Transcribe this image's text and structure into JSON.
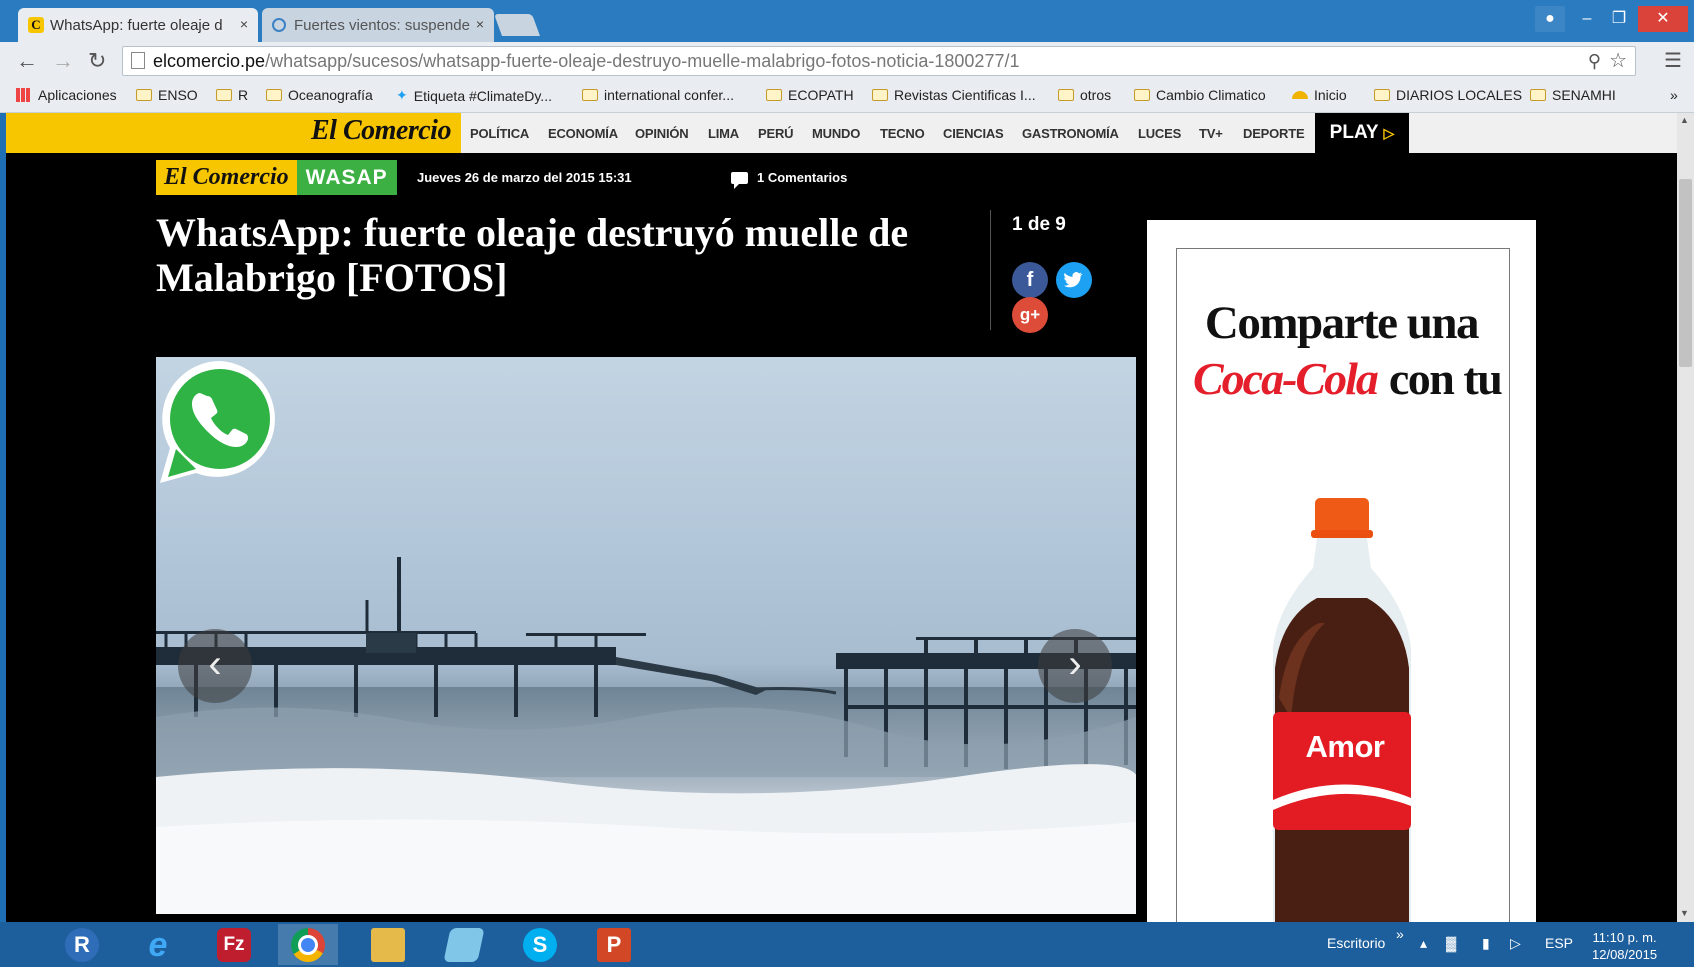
{
  "browser": {
    "tabs": [
      {
        "label": "WhatsApp: fuerte oleaje d",
        "close": "×",
        "active": true
      },
      {
        "label": "Fuertes vientos: suspende",
        "close": "×",
        "active": false
      }
    ],
    "url_host": "elcomercio.pe",
    "url_path": "/whatsapp/sucesos/whatsapp-fuerte-oleaje-destruyo-muelle-malabrigo-fotos-noticia-1800277/1",
    "bookmarks": [
      "Aplicaciones",
      "ENSO",
      "R",
      "Oceanografía",
      "Etiqueta #ClimateDy...",
      "international confer...",
      "ECOPATH",
      "Revistas Cientificas I...",
      "otros",
      "Cambio Climatico",
      "Inicio",
      "DIARIOS LOCALES",
      "SENAMHI"
    ],
    "bookmarks_overflow": "»"
  },
  "site": {
    "brand": "El Comercio",
    "nav": [
      "POLÍTICA",
      "ECONOMÍA",
      "OPINIÓN",
      "LIMA",
      "PERÚ",
      "MUNDO",
      "TECNO",
      "CIENCIAS",
      "GASTRONOMÍA",
      "LUCES",
      "TV+",
      "DEPORTE"
    ],
    "play_label": "PLAY"
  },
  "article": {
    "logo_brand": "El Comercio",
    "logo_section": "WASAP",
    "date": "Jueves 26 de marzo del 2015 15:31",
    "comments": "1 Comentarios",
    "headline": "WhatsApp: fuerte oleaje destruyó muelle de Malabrigo [FOTOS]",
    "counter": "1 de 9",
    "social": {
      "facebook": "f",
      "google": "g+"
    },
    "prev_glyph": "‹",
    "next_glyph": "›"
  },
  "ad": {
    "line1": "Comparte una",
    "brand_script": "Coca-Cola",
    "line2_rest": "con tu",
    "bottle_label": "Amor"
  },
  "taskbar": {
    "apps": [
      {
        "name": "R",
        "glyph": "R",
        "color": "#2f6db8"
      },
      {
        "name": "Internet Explorer",
        "glyph": "e",
        "color": "#1e90d6"
      },
      {
        "name": "FileZilla",
        "glyph": "Fz",
        "color": "#bf1e2e"
      },
      {
        "name": "Chrome",
        "glyph": "",
        "color": "#dd4b39"
      },
      {
        "name": "Explorer",
        "glyph": "",
        "color": "#e5b94a"
      },
      {
        "name": "Notepad",
        "glyph": "",
        "color": "#7fc6e8"
      },
      {
        "name": "Skype",
        "glyph": "S",
        "color": "#00aff0"
      },
      {
        "name": "PowerPoint",
        "glyph": "P",
        "color": "#d24726"
      }
    ],
    "desktop_label": "Escritorio",
    "overflow": "»",
    "language": "ESP",
    "time": "11:10 p. m.",
    "date": "12/08/2015"
  }
}
